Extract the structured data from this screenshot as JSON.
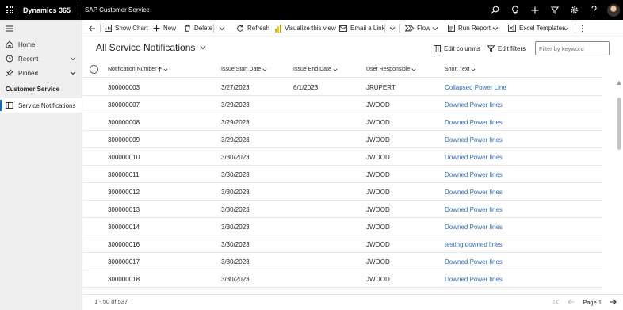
{
  "topbar": {
    "brand": "Dynamics 365",
    "app": "SAP Customer Service",
    "icons": [
      "search-icon",
      "lightbulb-icon",
      "plus-icon",
      "filter-icon",
      "gear-icon",
      "help-icon"
    ],
    "background": "#000000"
  },
  "sidebar": {
    "home": "Home",
    "recent": "Recent",
    "pinned": "Pinned",
    "area": "Customer Service",
    "service_notifications": "Service Notifications"
  },
  "toolbar": {
    "show_chart": "Show Chart",
    "new": "New",
    "delete": "Delete",
    "refresh": "Refresh",
    "visualize": "Visualize this view",
    "email_link": "Email a Link",
    "flow": "Flow",
    "run_report": "Run Report",
    "excel_templates": "Excel Templates"
  },
  "view": {
    "title": "All Service Notifications",
    "edit_columns": "Edit columns",
    "edit_filters": "Edit filters",
    "filter_placeholder": "Filter by keyword"
  },
  "columns": {
    "notification_number": "Notification Number",
    "issue_start_date": "Issue Start Date",
    "issue_end_date": "Issue End Date",
    "user_responsible": "User Responsible",
    "short_text": "Short Text"
  },
  "rows": [
    {
      "number": "300000003",
      "start": "3/27/2023",
      "end": "6/1/2023",
      "user": "JRUPERT",
      "text": "Collapsed Power Line"
    },
    {
      "number": "300000007",
      "start": "3/29/2023",
      "end": "",
      "user": "JWOOD",
      "text": "Downed Power lines"
    },
    {
      "number": "300000008",
      "start": "3/29/2023",
      "end": "",
      "user": "JWOOD",
      "text": "Downed Power lines"
    },
    {
      "number": "300000009",
      "start": "3/29/2023",
      "end": "",
      "user": "JWOOD",
      "text": "Downed Power lines"
    },
    {
      "number": "300000010",
      "start": "3/30/2023",
      "end": "",
      "user": "JWOOD",
      "text": "Downed Power lines"
    },
    {
      "number": "300000011",
      "start": "3/30/2023",
      "end": "",
      "user": "JWOOD",
      "text": "Downed Power lines"
    },
    {
      "number": "300000012",
      "start": "3/30/2023",
      "end": "",
      "user": "JWOOD",
      "text": "Downed Power lines"
    },
    {
      "number": "300000013",
      "start": "3/30/2023",
      "end": "",
      "user": "JWOOD",
      "text": "Downed Power lines"
    },
    {
      "number": "300000014",
      "start": "3/30/2023",
      "end": "",
      "user": "JWOOD",
      "text": "Downed Power lines"
    },
    {
      "number": "300000016",
      "start": "3/30/2023",
      "end": "",
      "user": "JWOOD",
      "text": "testing downed lines"
    },
    {
      "number": "300000017",
      "start": "3/30/2023",
      "end": "",
      "user": "JWOOD",
      "text": "Downed Power lines"
    },
    {
      "number": "300000018",
      "start": "3/30/2023",
      "end": "",
      "user": "JWOOD",
      "text": "Downed Power lines"
    }
  ],
  "footer": {
    "count": "1 - 50 of 537",
    "page": "Page 1"
  },
  "colors": {
    "link": "#2f6cb5",
    "accent": "#0f6cbd"
  }
}
